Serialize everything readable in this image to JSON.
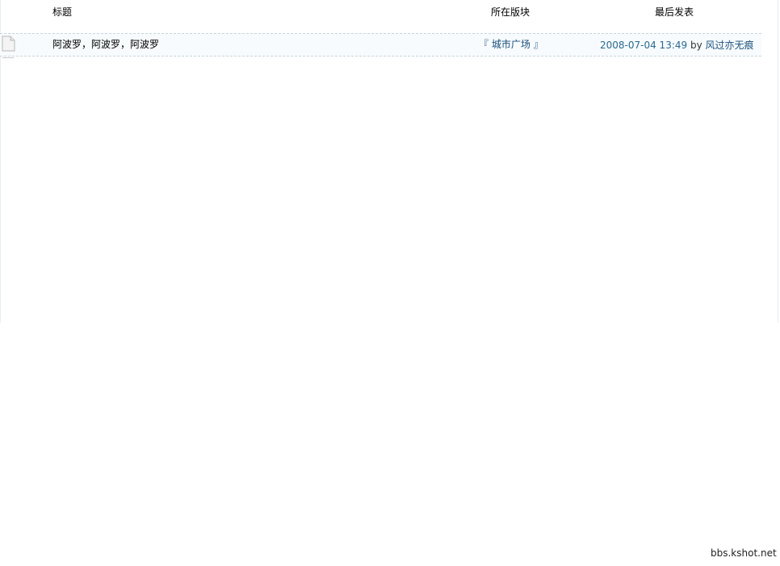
{
  "table": {
    "headers": {
      "title": "标题",
      "forum": "所在版块",
      "last_post": "最后发表"
    },
    "rows": [
      {
        "icon": "document-icon",
        "title": "阿波罗，阿波罗，阿波罗",
        "forum_open": "『",
        "forum": "城市广场",
        "forum_close": "』",
        "last_time": "2008-07-04 13:49",
        "by": "by",
        "last_user": "风过亦无痕"
      }
    ]
  },
  "watermark": "bbs.kshot.net",
  "colors": {
    "link": "#1a4f7a",
    "time": "#2a6a90",
    "row_bg": "#f7fbfd",
    "row_border": "#c9d6de"
  }
}
